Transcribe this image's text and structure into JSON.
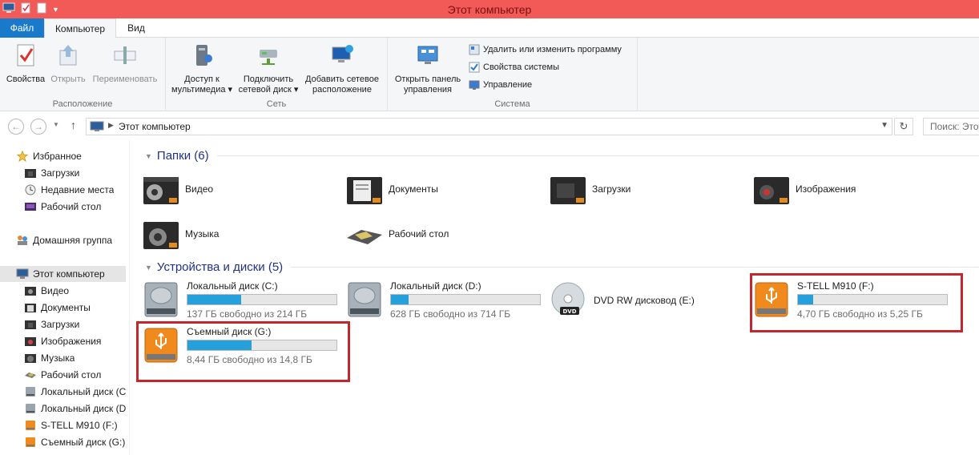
{
  "window": {
    "title": "Этот компьютер"
  },
  "ribbon": {
    "tabs": [
      "Файл",
      "Компьютер",
      "Вид"
    ],
    "groups": {
      "location": {
        "label": "Расположение",
        "buttons": [
          "Свойства",
          "Открыть",
          "Переименовать"
        ]
      },
      "network": {
        "label": "Сеть",
        "buttons": [
          {
            "line1": "Доступ к",
            "line2": "мультимедиа ▾"
          },
          {
            "line1": "Подключить",
            "line2": "сетевой диск ▾"
          },
          {
            "line1": "Добавить сетевое",
            "line2": "расположение"
          }
        ]
      },
      "system": {
        "label": "Система",
        "big_button": {
          "line1": "Открыть панель",
          "line2": "управления"
        },
        "small_buttons": [
          "Удалить или изменить программу",
          "Свойства системы",
          "Управление"
        ]
      }
    }
  },
  "address": {
    "path": "Этот компьютер",
    "search_placeholder": "Поиск: Этот"
  },
  "nav_pane": {
    "favorites": {
      "header": "Избранное",
      "items": [
        "Загрузки",
        "Недавние места",
        "Рабочий стол"
      ]
    },
    "homegroup": "Домашняя группа",
    "this_pc": {
      "header": "Этот компьютер",
      "items": [
        "Видео",
        "Документы",
        "Загрузки",
        "Изображения",
        "Музыка",
        "Рабочий стол",
        "Локальный диск (C",
        "Локальный диск (D",
        "S-TELL M910 (F:)",
        "Съемный диск (G:)"
      ]
    }
  },
  "folders": {
    "header": "Папки (6)",
    "items": [
      "Видео",
      "Документы",
      "Загрузки",
      "Изображения",
      "Музыка",
      "Рабочий стол"
    ]
  },
  "devices": {
    "header": "Устройства и диски (5)",
    "items": [
      {
        "name": "Локальный диск (C:)",
        "free": "137 ГБ свободно из 214 ГБ",
        "used_fraction": 0.36,
        "type": "hdd"
      },
      {
        "name": "Локальный диск (D:)",
        "free": "628 ГБ свободно из 714 ГБ",
        "used_fraction": 0.12,
        "type": "hdd"
      },
      {
        "name": "DVD RW дисковод (E:)",
        "type": "dvd"
      },
      {
        "name": "S-TELL M910 (F:)",
        "free": "4,70 ГБ свободно из 5,25 ГБ",
        "used_fraction": 0.1,
        "type": "usb"
      },
      {
        "name": "Съемный диск (G:)",
        "free": "8,44 ГБ свободно из 14,8 ГБ",
        "used_fraction": 0.43,
        "type": "usb"
      }
    ]
  },
  "colors": {
    "titlebar": "#f25a57",
    "file_tab": "#1979ca",
    "usage_bar": "#26a0da",
    "highlight_box": "#c1272d"
  }
}
